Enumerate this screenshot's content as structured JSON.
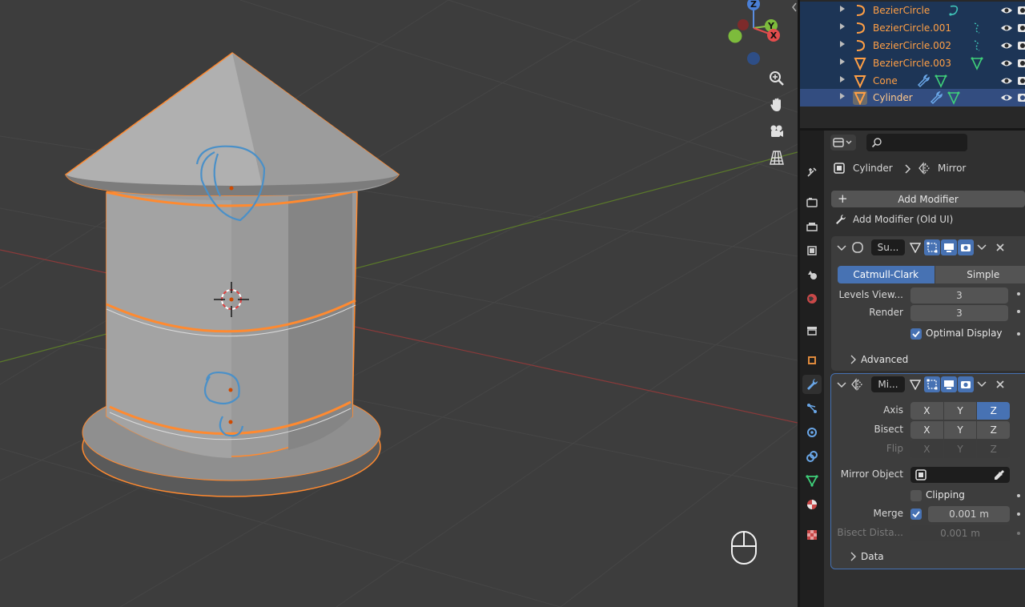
{
  "outliner": {
    "rows": [
      {
        "name": "BezierCircle",
        "type": "curve-icon"
      },
      {
        "name": "BezierCircle.001",
        "type": "curve-icon"
      },
      {
        "name": "BezierCircle.002",
        "type": "curve-icon"
      },
      {
        "name": "BezierCircle.003",
        "type": "mesh-icon"
      },
      {
        "name": "Cone",
        "type": "mesh-icon"
      },
      {
        "name": "Cylinder",
        "type": "mesh-icon"
      }
    ]
  },
  "properties": {
    "breadcrumb_object": "Cylinder",
    "breadcrumb_modifier": "Mirror",
    "add_modifier": "Add Modifier",
    "add_modifier_old": "Add Modifier (Old UI)",
    "subsurf": {
      "name": "Su...",
      "catmull": "Catmull-Clark",
      "simple": "Simple",
      "levels_label": "Levels View...",
      "levels_value": "3",
      "render_label": "Render",
      "render_value": "3",
      "optimal_label": "Optimal Display",
      "advanced_label": "Advanced"
    },
    "mirror": {
      "name": "Mi...",
      "axis_label": "Axis",
      "bisect_label": "Bisect",
      "flip_label": "Flip",
      "x": "X",
      "y": "Y",
      "z": "Z",
      "mirror_object_label": "Mirror Object",
      "clipping_label": "Clipping",
      "merge_label": "Merge",
      "merge_value": "0.001 m",
      "bisect_dist_label": "Bisect Dista...",
      "bisect_dist_value": "0.001 m",
      "data_label": "Data"
    }
  },
  "colors": {
    "selection_orange": "#ff8a30",
    "accent_blue": "#4772b3",
    "grease_pencil_blue": "#4a90c8"
  }
}
